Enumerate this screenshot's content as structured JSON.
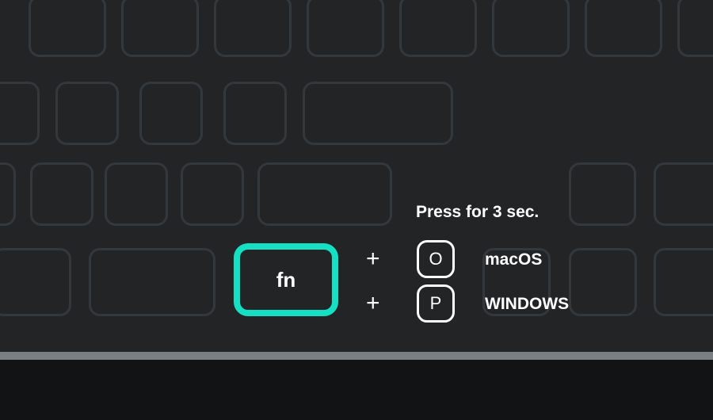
{
  "accent": "#16e0c4",
  "instruction": "Press for 3 sec.",
  "fn_label": "fn",
  "plus_symbol": "+",
  "combos": [
    {
      "key": "O",
      "os": "macOS"
    },
    {
      "key": "P",
      "os": "WINDOWS"
    }
  ]
}
